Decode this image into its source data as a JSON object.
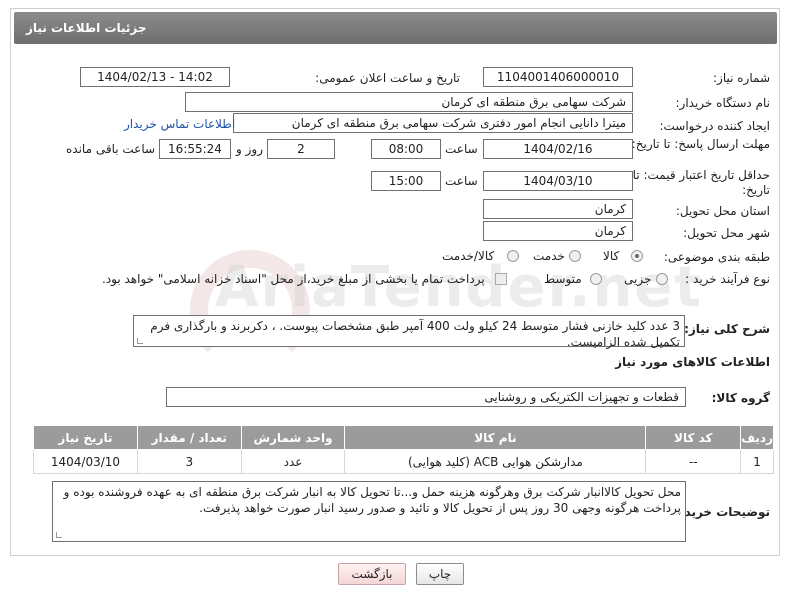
{
  "header": {
    "title": "جزئیات اطلاعات نیاز"
  },
  "form": {
    "need_number_label": "شماره نیاز:",
    "need_number": "1104001406000010",
    "announce_label": "تاریخ و ساعت اعلان عمومی:",
    "announce_value": "1404/02/13 - 14:02",
    "buyer_org_label": "نام دستگاه خریدار:",
    "buyer_org": "شرکت سهامی برق منطقه ای کرمان",
    "creator_label": "ایجاد کننده درخواست:",
    "creator": "میترا دانایی انجام امور دفتری شرکت سهامی برق منطقه ای کرمان",
    "contact_link": "اطلاعات تماس خریدار",
    "deadline_label": "مهلت ارسال پاسخ: تا تاریخ:",
    "deadline_date": "1404/02/16",
    "deadline_time_label": "ساعت",
    "deadline_time": "08:00",
    "days_value": "2",
    "days_label": "روز و",
    "remaining_time": "16:55:24",
    "remaining_label": "ساعت باقی مانده",
    "validity_label": "حداقل تاریخ اعتبار قیمت: تا تاریخ:",
    "validity_date": "1404/03/10",
    "validity_time_label": "ساعت",
    "validity_time": "15:00",
    "province_label": "استان محل تحویل:",
    "province": "کرمان",
    "city_label": "شهر محل تحویل:",
    "city": "کرمان",
    "category_label": "طبقه بندی موضوعی:",
    "category_options": [
      "کالا",
      "خدمت",
      "کالا/خدمت"
    ],
    "process_label": "نوع فرآیند خرید :",
    "process_options": [
      "جزیی",
      "متوسط"
    ],
    "treasury_note": "پرداخت تمام یا بخشی از مبلغ خرید،از محل \"اسناد خزانه اسلامی\" خواهد بود."
  },
  "description": {
    "label": "شرح کلی نیاز:",
    "text": "3 عدد کلید خازنی فشار متوسط 24 کیلو ولت 400 آمپر طبق مشخصات پیوست. ، دکربرند و بارگذاری فرم تکمیل شده الزامیست."
  },
  "goods": {
    "section_title": "اطلاعات کالاهای مورد نیاز",
    "group_label": "گروه کالا:",
    "group_value": "قطعات و تجهیزات الکتریکی و روشنایی",
    "columns": [
      "ردیف",
      "کد کالا",
      "نام کالا",
      "واحد شمارش",
      "تعداد / مقدار",
      "تاریخ نیاز"
    ],
    "rows": [
      {
        "index": "1",
        "code": "--",
        "name": "مدارشکن هوایی ACB (کلید هوایی)",
        "unit": "عدد",
        "qty": "3",
        "date": "1404/03/10"
      }
    ]
  },
  "buyer_notes": {
    "label": "توضیحات خریدار:",
    "text": "محل تحویل کالاانبار شرکت برق وهرگونه هزینه حمل و...تا تحویل کالا به انبار شرکت برق منطقه ای به عهده فروشنده بوده و پرداخت هرگونه وجهی 30 روز پس از تحویل کالا و تائید و صدور رسید انبار صورت خواهد پذیرفت."
  },
  "buttons": {
    "print": "چاپ",
    "back": "بازگشت"
  },
  "watermark": {
    "text": "AriaTender.net"
  },
  "colors": {
    "header": "#7d7d7d",
    "link": "#1f53a8",
    "table_header": "#9b9b9b"
  }
}
